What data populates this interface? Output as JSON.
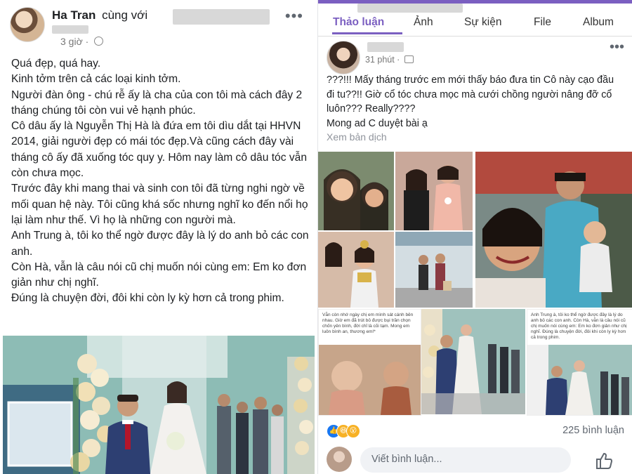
{
  "left_post": {
    "author": "Ha Tran",
    "with_text": "cùng với",
    "time": "3 giờ · ",
    "paragraphs": [
      "Quá đẹp, quá hay.",
      "Kinh tởm trên cả các loại kinh tởm.",
      "Người đàn ông - chú rễ ấy là cha của con tôi mà cách đây 2 tháng chúng tôi còn vui vẻ hạnh phúc.",
      "Cô dâu ấy là Nguyễn Thị Hà là đứa em tôi dìu dắt tại HHVN 2014, giải người đẹp có mái tóc đẹp.Và cũng cách đây vài tháng cô ấy đã xuống tóc  quy y. Hôm nay làm cô dâu tóc vẫn còn chưa mọc.",
      "Trước đây khi mang thai và sinh con tôi đã từng nghi ngờ về mối quan hệ này. Tôi cũng khá sốc nhưng nghĩ ko đến nổi họ lại làm như thế. Vì họ là những con người mà.",
      "Anh Trung à, tôi ko thể ngờ được đây là lý do anh bỏ các con anh.",
      "Còn Hà, vẫn là câu nói cũ chị muốn nói cùng em: Em ko đơn giản như chị nghĩ.",
      "Đúng là chuyện đời, đôi khi còn ly kỳ hơn cả trong phim."
    ]
  },
  "right_post": {
    "tabs": [
      "Thảo luận",
      "Ảnh",
      "Sự kiện",
      "File",
      "Album"
    ],
    "time": "31 phút · ",
    "paragraphs": [
      "???!!! Mấy tháng trước em mới thấy báo đưa tin Cô này cạo đầu đi tu??!! Giờ cổ tóc chưa mọc mà cưới chồng người nâng đỡ cổ luôn??? Really????",
      "Mong ad C duyệt bài ạ"
    ],
    "translate": "Xem bản dịch",
    "screenshot_text_left": "Vẫn còn nhớ ngày chị em mình sát cánh bên nhau. Giờ em đã trút bỏ được bụi trần chọn chốn yên bình, đời chỉ là cõi tạm. Mong em luôn bình an, thương em!*",
    "screenshot_text_right": "Anh Trung à, tôi ko thể ngờ được đây là lý do anh bỏ các con anh. Còn Hà, vẫn là câu nói cũ chị muốn nói cùng em: Em ko đơn giản như chị nghĩ. Đúng là chuyện đời, đôi khi còn ly kỳ hơn cả trong phim.",
    "comments_count": "225 bình luận",
    "comment_placeholder": "Viết bình luận..."
  },
  "colors": {
    "accent": "#7b5fc1",
    "text": "#1c1e21",
    "muted": "#606770"
  }
}
